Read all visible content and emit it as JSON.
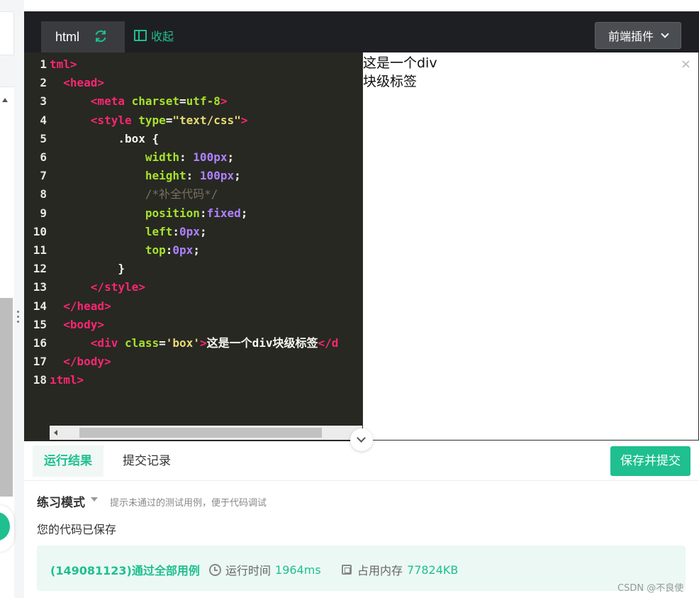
{
  "tabs": {
    "active_file": "html",
    "collapse_label": "收起"
  },
  "plugin_button": "前端插件",
  "code_lines": [
    {
      "n": "1",
      "parts": [
        [
          "tag",
          "tml>"
        ]
      ]
    },
    {
      "n": "2",
      "parts": [
        [
          "plain",
          "  "
        ],
        [
          "tag",
          "<head>"
        ]
      ]
    },
    {
      "n": "3",
      "parts": [
        [
          "plain",
          "      "
        ],
        [
          "tag",
          "<meta "
        ],
        [
          "attr",
          "charset"
        ],
        [
          "plain",
          "="
        ],
        [
          "attr",
          "utf-8"
        ],
        [
          "tag",
          ">"
        ]
      ]
    },
    {
      "n": "4",
      "parts": [
        [
          "plain",
          "      "
        ],
        [
          "tag",
          "<style "
        ],
        [
          "attr",
          "type"
        ],
        [
          "plain",
          "="
        ],
        [
          "str",
          "\"text/css\""
        ],
        [
          "tag",
          ">"
        ]
      ]
    },
    {
      "n": "5",
      "parts": [
        [
          "plain",
          "          .box {"
        ]
      ]
    },
    {
      "n": "6",
      "parts": [
        [
          "plain",
          "              "
        ],
        [
          "attr",
          "width"
        ],
        [
          "plain",
          ": "
        ],
        [
          "num",
          "100px"
        ],
        [
          "plain",
          ";"
        ]
      ]
    },
    {
      "n": "7",
      "parts": [
        [
          "plain",
          "              "
        ],
        [
          "attr",
          "height"
        ],
        [
          "plain",
          ": "
        ],
        [
          "num",
          "100px"
        ],
        [
          "plain",
          ";"
        ]
      ]
    },
    {
      "n": "8",
      "parts": [
        [
          "plain",
          "              "
        ],
        [
          "comment",
          "/*补全代码*/"
        ]
      ]
    },
    {
      "n": "9",
      "parts": [
        [
          "plain",
          "              "
        ],
        [
          "attr",
          "position"
        ],
        [
          "plain",
          ":"
        ],
        [
          "num",
          "fixed"
        ],
        [
          "plain",
          ";"
        ]
      ]
    },
    {
      "n": "10",
      "parts": [
        [
          "plain",
          "              "
        ],
        [
          "attr",
          "left"
        ],
        [
          "plain",
          ":"
        ],
        [
          "num",
          "0px"
        ],
        [
          "plain",
          ";"
        ]
      ]
    },
    {
      "n": "11",
      "parts": [
        [
          "plain",
          "              "
        ],
        [
          "attr",
          "top"
        ],
        [
          "plain",
          ":"
        ],
        [
          "num",
          "0px"
        ],
        [
          "plain",
          ";"
        ]
      ]
    },
    {
      "n": "12",
      "parts": [
        [
          "plain",
          "          }"
        ]
      ]
    },
    {
      "n": "13",
      "parts": [
        [
          "plain",
          "      "
        ],
        [
          "tag",
          "</style>"
        ]
      ]
    },
    {
      "n": "14",
      "parts": [
        [
          "plain",
          "  "
        ],
        [
          "tag",
          "</head>"
        ]
      ]
    },
    {
      "n": "15",
      "parts": [
        [
          "plain",
          "  "
        ],
        [
          "tag",
          "<body>"
        ]
      ]
    },
    {
      "n": "16",
      "parts": [
        [
          "plain",
          "      "
        ],
        [
          "tag",
          "<div "
        ],
        [
          "attr",
          "class"
        ],
        [
          "plain",
          "="
        ],
        [
          "str",
          "'box'"
        ],
        [
          "tag",
          ">"
        ],
        [
          "plain",
          "这是一个div块级标签"
        ],
        [
          "tag",
          "</d"
        ]
      ]
    },
    {
      "n": "17",
      "parts": [
        [
          "plain",
          "  "
        ],
        [
          "tag",
          "</body>"
        ]
      ]
    },
    {
      "n": "18",
      "parts": [
        [
          "tag",
          "ıtml>"
        ]
      ]
    }
  ],
  "preview": {
    "text": "这是一个div块级标签",
    "close_symbol": "×"
  },
  "result": {
    "tab_result": "运行结果",
    "tab_submit_log": "提交记录",
    "save_submit": "保存并提交",
    "mode": "练习模式",
    "mode_hint": "提示未通过的测试用例，便于代码调试",
    "saved_msg": "您的代码已保存",
    "pass_text": "(149081123)通过全部用例",
    "runtime_label": "运行时间",
    "runtime_value": "1964ms",
    "memory_label": "占用内存",
    "memory_value": "77824KB"
  },
  "watermark": "CSDN @不良使",
  "colors": {
    "accent": "#1fbf8f",
    "editor_bg": "#272822",
    "topbar_bg": "#1e1f23"
  }
}
